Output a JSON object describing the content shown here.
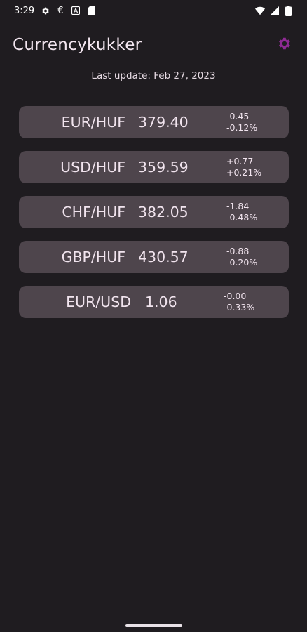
{
  "status_bar": {
    "time": "3:29",
    "icons": [
      "gear-icon",
      "euro-icon",
      "a-box-icon",
      "sim-card-icon",
      "wifi-icon",
      "signal-icon",
      "battery-icon"
    ],
    "euro_glyph": "€"
  },
  "app_bar": {
    "title": "Currencykukker",
    "settings_icon": "gear-icon",
    "accent_color": "#8e2a93"
  },
  "last_update": "Last update: Feb 27, 2023",
  "rates": [
    {
      "pair": "EUR/HUF",
      "rate": "379.40",
      "change_abs": "-0.45",
      "change_pct": "-0.12%"
    },
    {
      "pair": "USD/HUF",
      "rate": "359.59",
      "change_abs": "+0.77",
      "change_pct": "+0.21%"
    },
    {
      "pair": "CHF/HUF",
      "rate": "382.05",
      "change_abs": "-1.84",
      "change_pct": "-0.48%"
    },
    {
      "pair": "GBP/HUF",
      "rate": "430.57",
      "change_abs": "-0.88",
      "change_pct": "-0.20%"
    },
    {
      "pair": "EUR/USD",
      "rate": "1.06",
      "change_abs": "-0.00",
      "change_pct": "-0.33%"
    }
  ],
  "colors": {
    "background": "#1f1c20",
    "card": "#4e454c",
    "text": "#f1e4ee"
  }
}
